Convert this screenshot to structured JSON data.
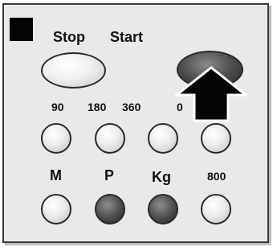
{
  "controls": {
    "top_labels": {
      "stop": "Stop",
      "start": "Start"
    },
    "row1_labels": [
      "90",
      "180",
      "360",
      "0"
    ],
    "row2_labels": [
      "M",
      "P",
      "Kg",
      "800"
    ]
  },
  "icons": {
    "status_indicator": "black-square-icon",
    "pointer": "up-arrow-icon"
  },
  "colors": {
    "panel_bg": "#e9e9e9",
    "button_light": "#eeeeee",
    "button_dark": "#4a4a4a",
    "indicator": "#050505"
  }
}
